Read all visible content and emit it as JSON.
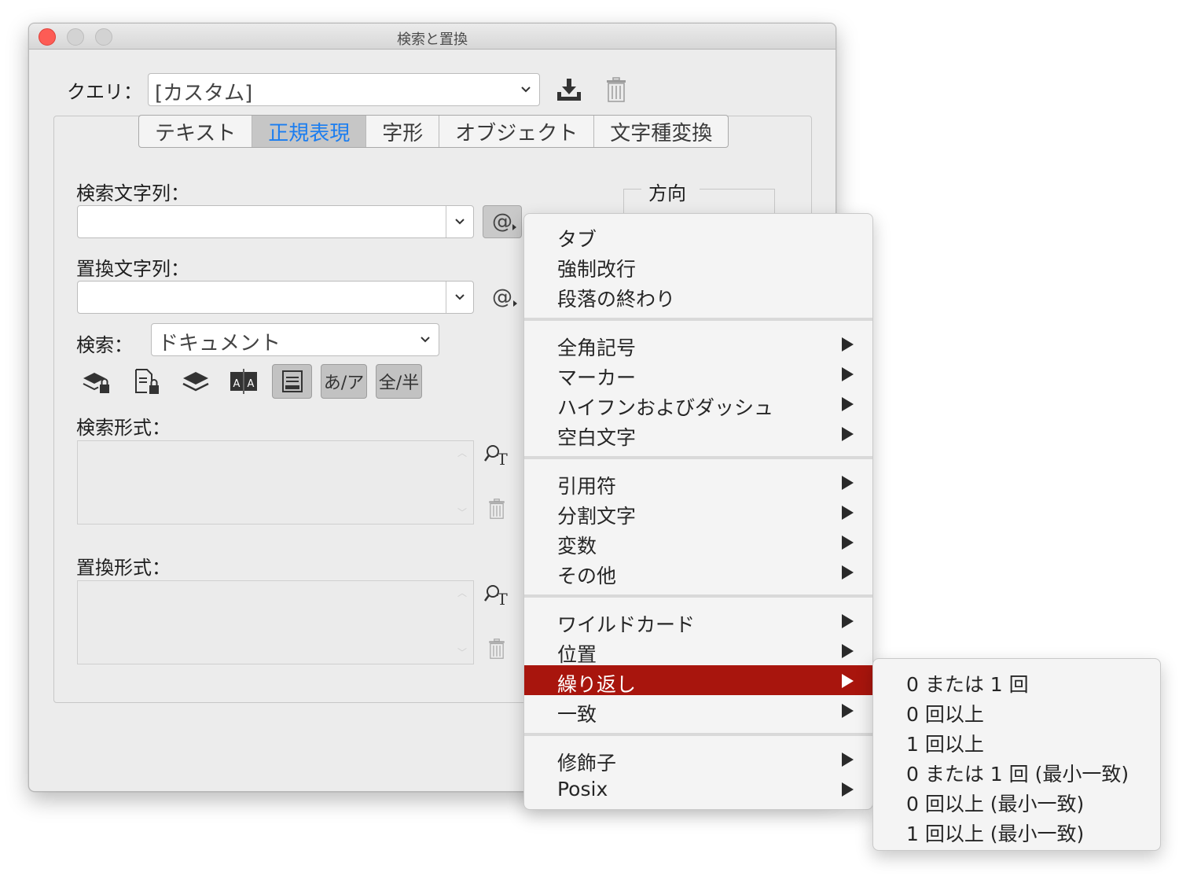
{
  "window": {
    "title": "検索と置換"
  },
  "query": {
    "label": "クエリ：",
    "value": "[カスタム]"
  },
  "tabs": [
    "テキスト",
    "正規表現",
    "字形",
    "オブジェクト",
    "文字種変換"
  ],
  "find": {
    "label": "検索文字列：",
    "value": ""
  },
  "replace": {
    "label": "置換文字列：",
    "value": ""
  },
  "direction": {
    "label": "方向"
  },
  "search": {
    "label": "検索：",
    "value": "ドキュメント"
  },
  "options": {
    "kana_toggle": "あ/ア",
    "width_toggle": "全/半"
  },
  "find_format": {
    "label": "検索形式："
  },
  "replace_format": {
    "label": "置換形式："
  },
  "special_char_symbol": "@",
  "menu": {
    "group1": [
      "タブ",
      "強制改行",
      "段落の終わり"
    ],
    "group2": [
      "全角記号",
      "マーカー",
      "ハイフンおよびダッシュ",
      "空白文字"
    ],
    "group3": [
      "引用符",
      "分割文字",
      "変数",
      "その他"
    ],
    "group4": [
      "ワイルドカード",
      "位置",
      "繰り返し",
      "一致"
    ],
    "group5": [
      "修飾子",
      "Posix"
    ],
    "highlighted": "繰り返し",
    "highlight_color": "#a8150d"
  },
  "submenu": {
    "items": [
      "0 または 1 回",
      "0 回以上",
      "1 回以上",
      "0 または 1 回 (最小一致)",
      "0 回以上 (最小一致)",
      "1 回以上 (最小一致)"
    ]
  }
}
